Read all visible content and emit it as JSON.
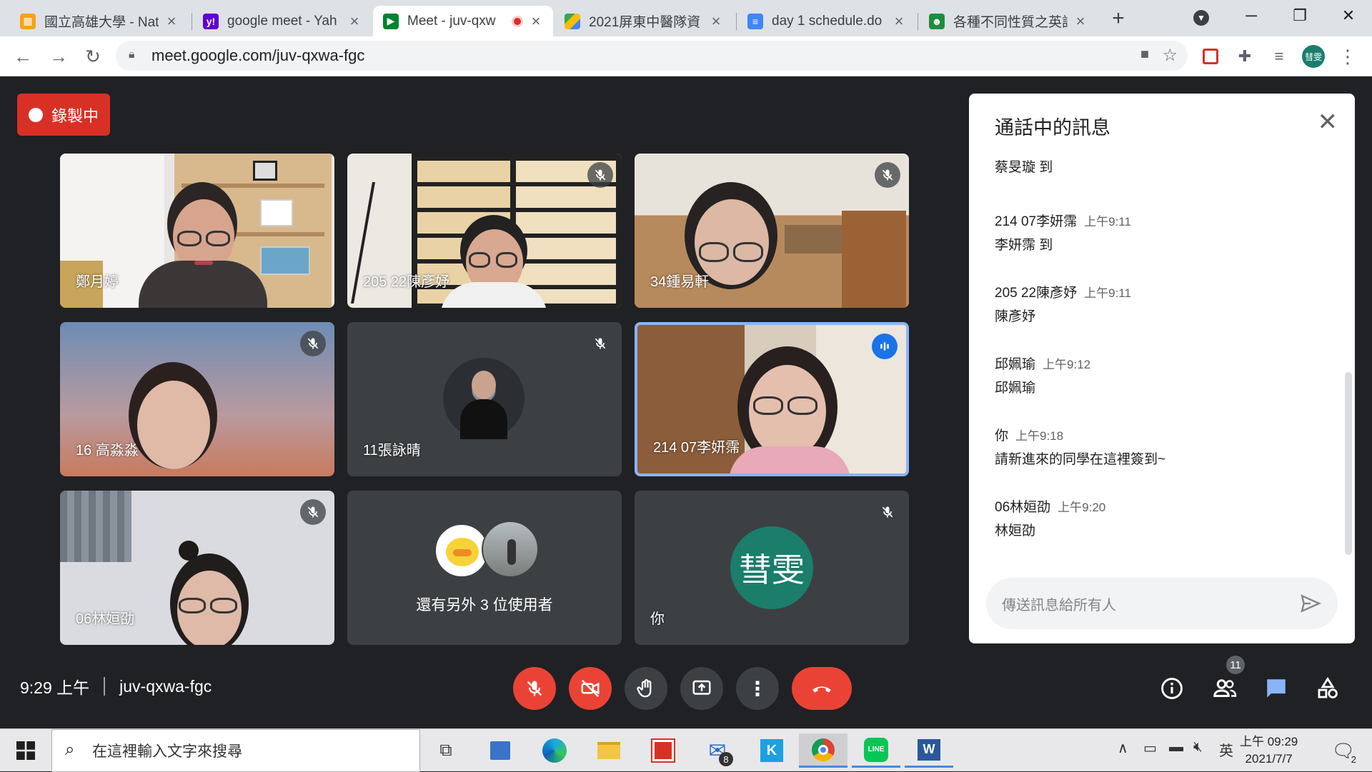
{
  "browser": {
    "tabs": [
      {
        "title": "國立高雄大學 - Nat",
        "icon": "nuk-favicon"
      },
      {
        "title": "google meet - Yah",
        "icon": "yahoo-favicon"
      },
      {
        "title": "Meet - juv-qxw",
        "icon": "meet-favicon",
        "active": true
      },
      {
        "title": "2021屏東中醫隊資",
        "icon": "drive-favicon"
      },
      {
        "title": "day 1 schedule.do",
        "icon": "docs-favicon"
      },
      {
        "title": "各種不同性質之英語",
        "icon": "classroom-favicon"
      }
    ],
    "url": "meet.google.com/juv-qxwa-fgc",
    "profile_initials": "彗雯"
  },
  "meet": {
    "recording_label": "錄製中",
    "tiles": [
      {
        "name": "鄭月婷",
        "muted": false
      },
      {
        "name": "205 22陳彥妤",
        "muted": true
      },
      {
        "name": "34鍾易軒",
        "muted": true
      },
      {
        "name": "16 高淼淼",
        "muted": true
      },
      {
        "name": "11張詠晴",
        "muted": true
      },
      {
        "name": "214 07李妍霈",
        "muted": false,
        "speaking": true
      },
      {
        "name": "06林姮劭",
        "muted": true
      },
      {
        "name": "還有另外 3 位使用者",
        "muted": false
      },
      {
        "name": "你",
        "muted": true,
        "avatar": "彗雯"
      }
    ],
    "chat": {
      "title": "通話中的訊息",
      "messages": [
        {
          "sender": "",
          "time": "",
          "text": "蔡旻璇 到"
        },
        {
          "sender": "214 07李妍霈",
          "time": "上午9:11",
          "text": "李妍霈 到"
        },
        {
          "sender": "205 22陳彥妤",
          "time": "上午9:11",
          "text": "陳彥妤"
        },
        {
          "sender": "邱姵瑜",
          "time": "上午9:12",
          "text": "邱姵瑜"
        },
        {
          "sender": "你",
          "time": "上午9:18",
          "text": "請新進來的同學在這裡簽到~"
        },
        {
          "sender": "06林姮劭",
          "time": "上午9:20",
          "text": "林姮劭"
        }
      ],
      "input_placeholder": "傳送訊息給所有人"
    },
    "time": "9:29 上午",
    "meeting_code": "juv-qxwa-fgc",
    "participant_count": "11",
    "colors": {
      "end_call": "#ea4335",
      "speaking": "#8ab4f8",
      "avatar": "#1a7e6b"
    }
  },
  "taskbar": {
    "search_placeholder": "在這裡輸入文字來搜尋",
    "mail_badge": "8",
    "ime": "英",
    "clock_time": "上午 09:29",
    "clock_date": "2021/7/7",
    "notification_count": "2"
  }
}
